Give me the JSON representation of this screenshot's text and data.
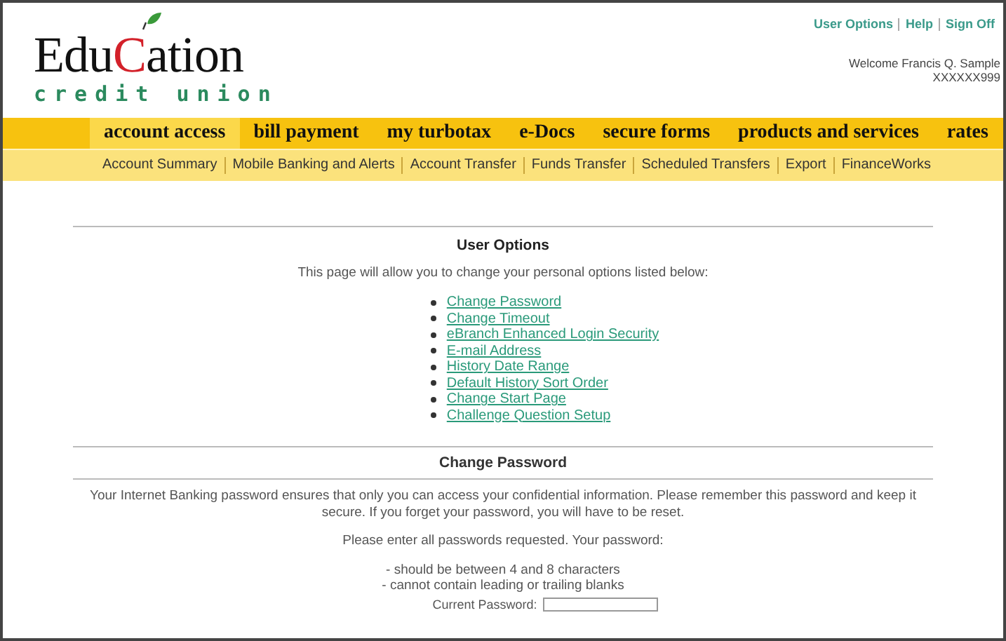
{
  "logo": {
    "word_start": "Edu",
    "apple_letter": "C",
    "word_end": "ation",
    "tagline": "credit union"
  },
  "top_links": [
    {
      "label": "User Options"
    },
    {
      "label": "Help"
    },
    {
      "label": "Sign Off"
    }
  ],
  "welcome": {
    "greeting": "Welcome Francis Q. Sample",
    "account": "XXXXXX999"
  },
  "nav_tabs": [
    {
      "label": "account access",
      "selected": true
    },
    {
      "label": "bill payment",
      "selected": false
    },
    {
      "label": "my turbotax",
      "selected": false
    },
    {
      "label": "e-Docs",
      "selected": false
    },
    {
      "label": "secure forms",
      "selected": false
    },
    {
      "label": "products and services",
      "selected": false
    },
    {
      "label": "rates",
      "selected": false
    }
  ],
  "sub_nav": [
    "Account Summary",
    "Mobile Banking and Alerts",
    "Account Transfer",
    "Funds Transfer",
    "Scheduled Transfers",
    "Export",
    "FinanceWorks"
  ],
  "user_options": {
    "title": "User Options",
    "intro": "This page will allow you to change your personal options listed below:",
    "links": [
      "Change Password",
      "Change Timeout",
      "eBranch Enhanced Login Security",
      "E-mail Address",
      "History Date Range",
      "Default History Sort Order",
      "Change Start Page",
      "Challenge Question Setup"
    ]
  },
  "change_password": {
    "title": "Change Password",
    "explanation": "Your Internet Banking password ensures that only you can access your confidential information. Please remember this password and keep it secure. If you forget your password, you will have to be reset.",
    "instruction": "Please enter all passwords requested. Your password:",
    "rules": [
      "- should be between 4 and 8 characters",
      "- cannot contain leading or trailing blanks"
    ],
    "field_label": "Current Password:"
  }
}
